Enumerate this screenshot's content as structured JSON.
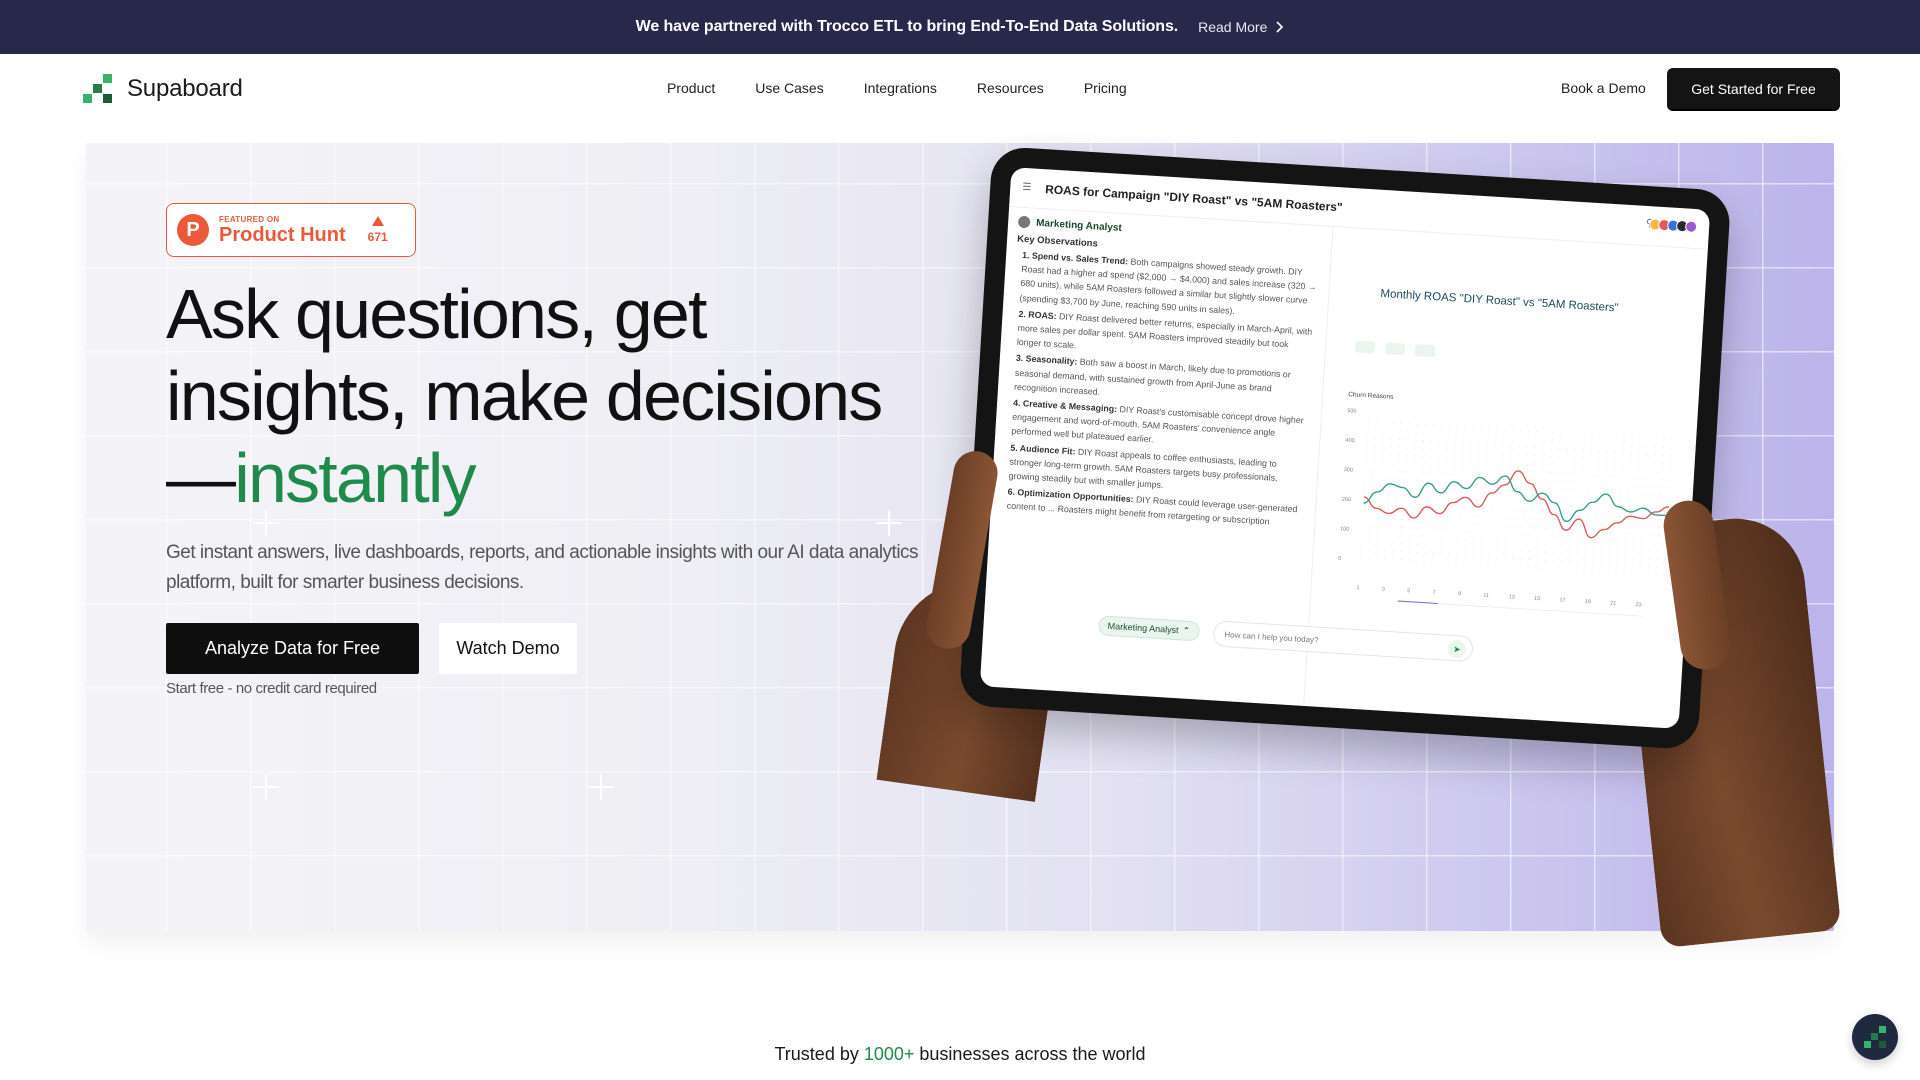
{
  "announcement": {
    "text": "We have partnered with Trocco ETL to bring End-To-End Data Solutions.",
    "link": "Read More"
  },
  "nav": {
    "brand": "Supaboard",
    "links": [
      "Product",
      "Use Cases",
      "Integrations",
      "Resources",
      "Pricing"
    ],
    "demo": "Book a Demo",
    "cta": "Get Started for Free"
  },
  "hero": {
    "badge": {
      "small": "FEATURED ON",
      "name": "Product Hunt",
      "votes": "671"
    },
    "headline": {
      "line1": "Ask questions, get",
      "line2": "insights, make decisions",
      "line3_prefix": "—",
      "line3_highlight": "instantly"
    },
    "subtext": "Get instant answers, live dashboards, reports, and actionable insights with our AI data analytics platform, built for smarter business decisions.",
    "primary_cta": "Analyze Data for Free",
    "secondary_cta": "Watch Demo",
    "fine_print": "Start free - no credit card required"
  },
  "tablet": {
    "title": "ROAS for Campaign \"DIY Roast\" vs \"5AM Roasters\"",
    "agent": "Marketing Analyst",
    "observations_heading": "Key Observations",
    "observations": [
      {
        "label": "1. Spend vs. Sales Trend:",
        "text": "Both campaigns showed steady growth. DIY Roast had a higher ad spend ($2,000 → $4,000) and sales increase (320 → 680 units), while 5AM Roasters followed a similar but slightly slower curve (spending $3,700 by June, reaching 590 units in sales)."
      },
      {
        "label": "2. ROAS:",
        "text": "DIY Roast delivered better returns, especially in March-April, with more sales per dollar spent. 5AM Roasters improved steadily but took longer to scale."
      },
      {
        "label": "3. Seasonality:",
        "text": "Both saw a boost in March, likely due to promotions or seasonal demand, with sustained growth from April-June as brand recognition increased."
      },
      {
        "label": "4. Creative & Messaging:",
        "text": "DIY Roast's customisable concept drove higher engagement and word-of-mouth. 5AM Roasters' convenience angle performed well but plateaued earlier."
      },
      {
        "label": "5. Audience Fit:",
        "text": "DIY Roast appeals to coffee enthusiasts, leading to stronger long-term growth. 5AM Roasters targets busy professionals, growing steadily but with smaller jumps."
      },
      {
        "label": "6. Optimization Opportunities:",
        "text": "DIY Roast could leverage user-generated content to ... Roasters might benefit from retargeting or subscription"
      }
    ],
    "chip": "Marketing Analyst",
    "input_placeholder": "How can I help you today?",
    "chart_title": "Monthly ROAS  \"DIY Roast\" vs \"5AM Roasters\"",
    "chart_subtitle": "Churn Reasons"
  },
  "chart_data": {
    "type": "line",
    "title": "Monthly ROAS  \"DIY Roast\" vs \"5AM Roasters\"",
    "subtitle": "Churn Reasons",
    "x": [
      1,
      2,
      3,
      4,
      5,
      6,
      7,
      8,
      9,
      10,
      11,
      12,
      13,
      14,
      15,
      16,
      17,
      18,
      19,
      20,
      21,
      22,
      23,
      24,
      25
    ],
    "xticks": [
      1,
      3,
      5,
      7,
      9,
      11,
      13,
      15,
      17,
      19,
      21,
      23
    ],
    "yticks": [
      0,
      100,
      200,
      300,
      400,
      500
    ],
    "ylim": [
      0,
      500
    ],
    "series": [
      {
        "color": "#e05a5a",
        "values": [
          210,
          175,
          160,
          180,
          150,
          190,
          170,
          210,
          230,
          200,
          250,
          280,
          330,
          290,
          240,
          190,
          140,
          180,
          120,
          150,
          175,
          200,
          195,
          220,
          240
        ]
      },
      {
        "color": "#3a9e8c",
        "values": [
          190,
          230,
          260,
          250,
          220,
          270,
          240,
          280,
          260,
          300,
          280,
          310,
          260,
          230,
          260,
          230,
          170,
          210,
          240,
          270,
          230,
          215,
          230,
          210,
          210
        ]
      }
    ]
  },
  "trusted": {
    "prefix": "Trusted by ",
    "highlight": "1000+",
    "suffix": " businesses across the world"
  },
  "colors": {
    "brand_green": "#1f8a4c",
    "announce_bg": "#28284a",
    "product_hunt": "#ea5a3a"
  },
  "icons": {
    "read_more": "chevron-right-icon",
    "brand": "supaboard-logo-icon",
    "chat": "supaboard-chat-icon"
  }
}
